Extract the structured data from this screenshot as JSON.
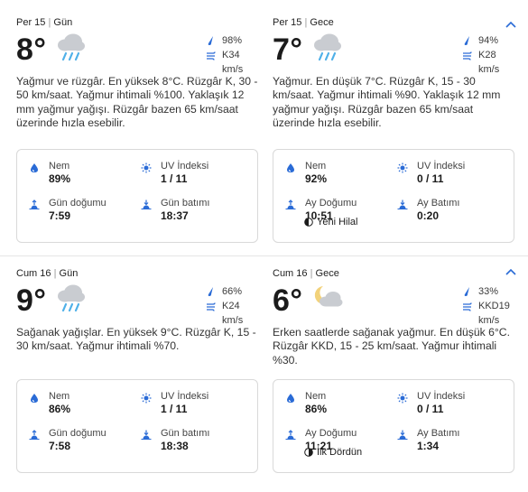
{
  "days": [
    {
      "day": {
        "period_day": "Per 15",
        "period_name": "Gün",
        "temp": "8°",
        "precip": "98%",
        "wind": "K34 km/s",
        "desc": "Yağmur ve rüzgâr. En yüksek 8°C. Rüzgâr K, 30 - 50 km/saat. Yağmur ihtimali %100. Yaklaşık 12 mm yağmur yağışı. Rüzgâr bazen 65 km/saat üzerinde hızla esebilir.",
        "humidity_label": "Nem",
        "humidity": "89%",
        "uv_label": "UV İndeksi",
        "uv": "1 / 11",
        "rise_label": "Gün doğumu",
        "rise": "7:59",
        "set_label": "Gün batımı",
        "set": "18:37"
      },
      "night": {
        "period_day": "Per 15",
        "period_name": "Gece",
        "temp": "7°",
        "precip": "94%",
        "wind": "K28 km/s",
        "desc": "Yağmur. En düşük 7°C. Rüzgâr K, 15 - 30 km/saat. Yağmur ihtimali %90. Yaklaşık 12 mm yağmur yağışı. Rüzgâr bazen 65 km/saat üzerinde hızla esebilir.",
        "humidity_label": "Nem",
        "humidity": "92%",
        "uv_label": "UV İndeksi",
        "uv": "0 / 11",
        "rise_label": "Ay Doğumu",
        "rise": "10:51",
        "set_label": "Ay Batımı",
        "set": "0:20",
        "moon_phase": "Yeni Hilal"
      }
    },
    {
      "day": {
        "period_day": "Cum 16",
        "period_name": "Gün",
        "temp": "9°",
        "precip": "66%",
        "wind": "K24 km/s",
        "desc": "Sağanak yağışlar. En yüksek 9°C. Rüzgâr K, 15 - 30 km/saat. Yağmur ihtimali %70.",
        "humidity_label": "Nem",
        "humidity": "86%",
        "uv_label": "UV İndeksi",
        "uv": "1 / 11",
        "rise_label": "Gün doğumu",
        "rise": "7:58",
        "set_label": "Gün batımı",
        "set": "18:38"
      },
      "night": {
        "period_day": "Cum 16",
        "period_name": "Gece",
        "temp": "6°",
        "precip": "33%",
        "wind": "KKD19 km/s",
        "desc": "Erken saatlerde sağanak yağmur. En düşük 6°C. Rüzgâr KKD, 15 - 25 km/saat. Yağmur ihtimali %30.",
        "humidity_label": "Nem",
        "humidity": "86%",
        "uv_label": "UV İndeksi",
        "uv": "0 / 11",
        "rise_label": "Ay Doğumu",
        "rise": "11:21",
        "set_label": "Ay Batımı",
        "set": "1:34",
        "moon_phase": "İlk Dördün"
      }
    }
  ],
  "icons": {
    "weather_day1": "rain-cloud-icon",
    "weather_night1": "night-rain-icon",
    "weather_day2": "rain-cloud-icon",
    "weather_night2": "partly-cloudy-night-icon",
    "precip": "raindrop-icon",
    "wind": "wind-icon",
    "humidity": "humidity-drop-icon",
    "uv": "sun-icon",
    "sunrise": "sunrise-icon",
    "sunset": "sunset-icon",
    "moonrise": "moonrise-icon",
    "moonset": "moonset-icon",
    "moon_phase": "moon-phase-icon",
    "collapse": "chevron-up-icon"
  },
  "colors": {
    "accent": "#2a6bd6",
    "cloud": "#c9ccd1",
    "rain": "#4fb0e8",
    "moon": "#f2c94c",
    "text": "#1b1b1b"
  }
}
